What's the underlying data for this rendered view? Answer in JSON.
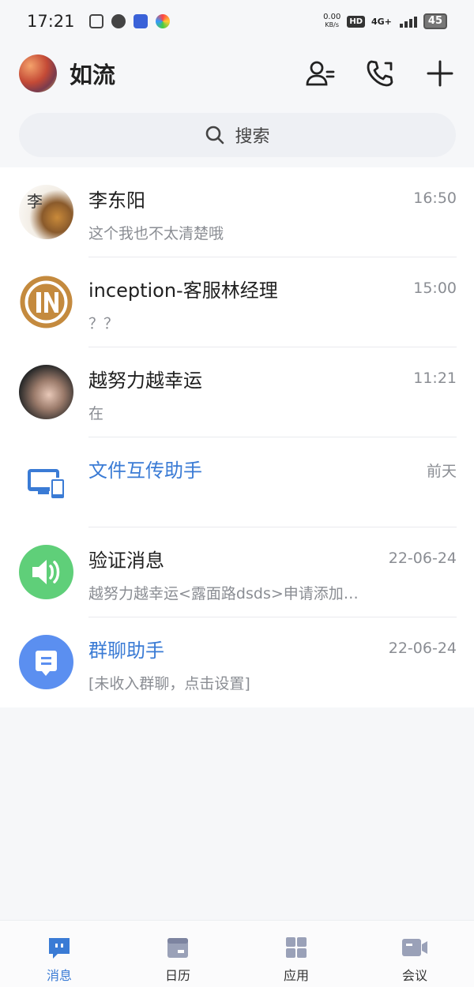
{
  "status_bar": {
    "time": "17:21",
    "net_speed_value": "0.00",
    "net_speed_unit": "KB/s",
    "hd": "HD",
    "network": "4G+",
    "battery": "45"
  },
  "header": {
    "title": "如流"
  },
  "search": {
    "label": "搜索"
  },
  "chats": [
    {
      "name": "李东阳",
      "preview": "这个我也不太清楚哦",
      "time": "16:50",
      "name_color": "default"
    },
    {
      "name": "inception-客服林经理",
      "preview": "？？",
      "time": "15:00",
      "name_color": "default"
    },
    {
      "name": "越努力越幸运",
      "preview": "在",
      "time": "11:21",
      "name_color": "default"
    },
    {
      "name": "文件互传助手",
      "preview": "",
      "time": "前天",
      "name_color": "#3a7bd5"
    },
    {
      "name": "验证消息",
      "preview": "越努力越幸运<露面路dsds>申请添加…",
      "time": "22-06-24",
      "name_color": "default"
    },
    {
      "name": "群聊助手",
      "preview": "[未收入群聊，点击设置]",
      "time": "22-06-24",
      "name_color": "#3a7bd5"
    }
  ],
  "bottom_nav": {
    "items": [
      {
        "label": "消息",
        "icon": "message-icon",
        "active": true
      },
      {
        "label": "日历",
        "icon": "calendar-icon",
        "active": false
      },
      {
        "label": "应用",
        "icon": "apps-grid-icon",
        "active": false
      },
      {
        "label": "会议",
        "icon": "video-meeting-icon",
        "active": false
      }
    ]
  },
  "colors": {
    "accent": "#3a7bd5",
    "verify_green": "#5fcf79",
    "group_blue": "#5b8ff0",
    "nav_gray": "#9aa1b8"
  }
}
